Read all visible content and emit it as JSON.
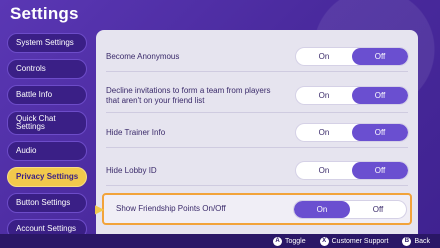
{
  "title": "Settings",
  "sidebar": {
    "items": [
      {
        "label": "System Settings"
      },
      {
        "label": "Controls"
      },
      {
        "label": "Battle Info"
      },
      {
        "label": "Quick Chat Settings"
      },
      {
        "label": "Audio"
      },
      {
        "label": "Privacy Settings",
        "active": true
      },
      {
        "label": "Button Settings"
      },
      {
        "label": "Account Settings"
      }
    ]
  },
  "main": {
    "rows": [
      {
        "label": "Become Anonymous",
        "on": "On",
        "off": "Off",
        "value": "Off"
      },
      {
        "label": "Decline invitations to form a team from players that aren't on your friend list",
        "on": "On",
        "off": "Off",
        "value": "Off"
      },
      {
        "label": "Hide Trainer Info",
        "on": "On",
        "off": "Off",
        "value": "Off"
      },
      {
        "label": "Hide Lobby ID",
        "on": "On",
        "off": "Off",
        "value": "Off"
      },
      {
        "label": "Show Friendship Points On/Off",
        "on": "On",
        "off": "Off",
        "value": "On"
      }
    ]
  },
  "footer": {
    "hints": [
      {
        "glyph": "A",
        "label": "Toggle",
        "icon": "a-button-icon"
      },
      {
        "glyph": "X",
        "label": "Customer Support",
        "icon": "x-button-icon"
      },
      {
        "glyph": "B",
        "label": "Back",
        "icon": "b-button-icon"
      }
    ]
  },
  "colors": {
    "background": "#4a2a9a",
    "accent": "#6a4fd0",
    "highlight": "#f2c94c",
    "selection_border": "#f2a33a"
  }
}
